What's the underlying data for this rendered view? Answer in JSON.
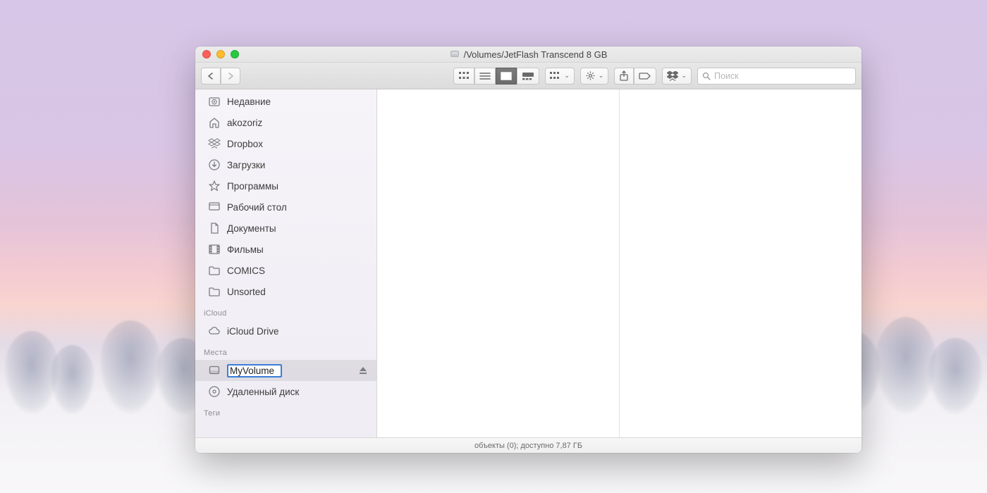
{
  "window": {
    "title": "/Volumes/JetFlash Transcend 8 GB"
  },
  "toolbar": {
    "search_placeholder": "Поиск",
    "arrange_icon": "arrange",
    "action_icon": "gear"
  },
  "sidebar": {
    "favorites": [
      {
        "label": "Недавние",
        "icon": "recents"
      },
      {
        "label": "akozoriz",
        "icon": "home"
      },
      {
        "label": "Dropbox",
        "icon": "dropbox"
      },
      {
        "label": "Загрузки",
        "icon": "downloads"
      },
      {
        "label": "Программы",
        "icon": "applications"
      },
      {
        "label": "Рабочий стол",
        "icon": "desktop"
      },
      {
        "label": "Документы",
        "icon": "documents"
      },
      {
        "label": "Фильмы",
        "icon": "movies"
      },
      {
        "label": "COMICS",
        "icon": "folder"
      },
      {
        "label": "Unsorted",
        "icon": "folder"
      }
    ],
    "sections": {
      "icloud": "iCloud",
      "icloud_drive": "iCloud Drive",
      "locations": "Места",
      "tags": "Теги"
    },
    "locations": [
      {
        "label": "MyVolume",
        "icon": "external",
        "editing": true,
        "ejectable": true
      },
      {
        "label": "Удаленный диск",
        "icon": "remote-disc"
      }
    ]
  },
  "status": {
    "text": "объекты (0); доступно 7,87 ГБ"
  }
}
